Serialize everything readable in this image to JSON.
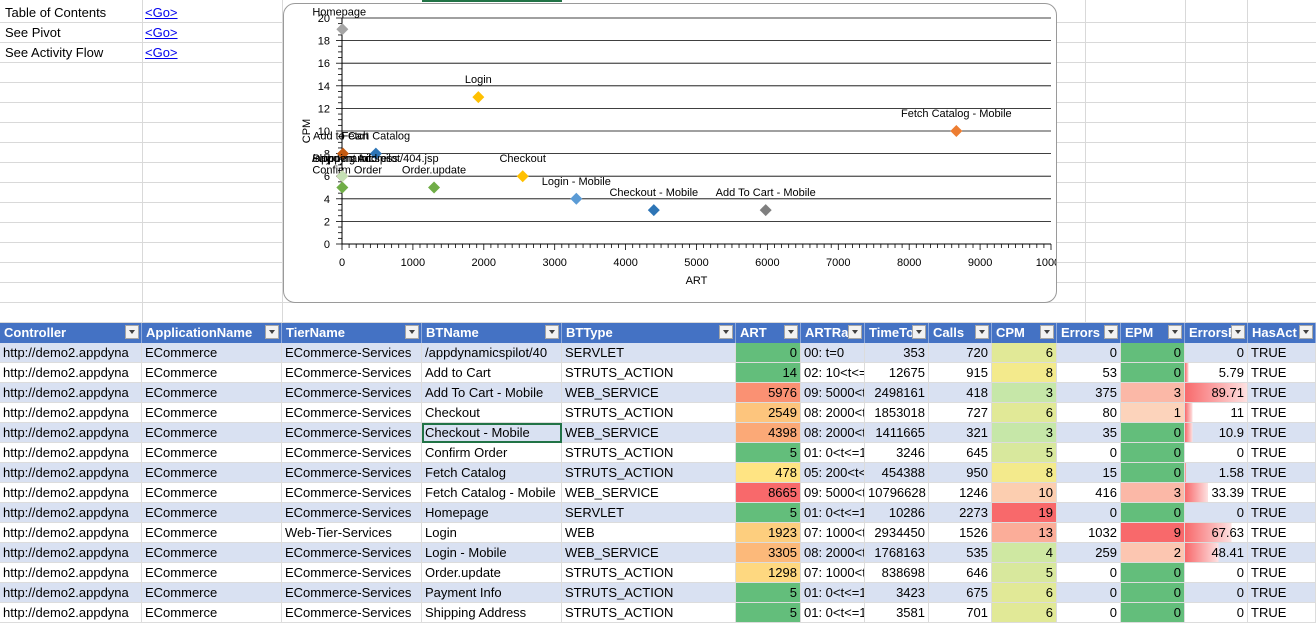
{
  "links": [
    {
      "label": "Table of Contents",
      "link": "<Go>"
    },
    {
      "label": "See Pivot",
      "link": "<Go>"
    },
    {
      "label": "See Activity Flow",
      "link": "<Go>"
    }
  ],
  "chart_data": {
    "type": "scatter",
    "title": "",
    "xlabel": "ART",
    "ylabel": "CPM",
    "xlim": [
      0,
      10000
    ],
    "ylim": [
      0,
      20
    ],
    "xticks": [
      0,
      1000,
      2000,
      3000,
      4000,
      5000,
      6000,
      7000,
      8000,
      9000,
      10000
    ],
    "yticks": [
      0,
      2,
      4,
      6,
      8,
      10,
      12,
      14,
      16,
      18,
      20
    ],
    "grid": "horizontal",
    "points": [
      {
        "label": "/appdynamicspilot/404.jsp",
        "x": 0,
        "y": 6,
        "color": "#7f7f7f"
      },
      {
        "label": "Add to Cart",
        "x": 14,
        "y": 8,
        "color": "#c55a11"
      },
      {
        "label": "Add To Cart - Mobile",
        "x": 5976,
        "y": 3,
        "color": "#7f7f7f"
      },
      {
        "label": "Checkout",
        "x": 2549,
        "y": 6,
        "color": "#ffc000"
      },
      {
        "label": "Checkout - Mobile",
        "x": 4398,
        "y": 3,
        "color": "#2e75b6"
      },
      {
        "label": "Confirm Order",
        "x": 5,
        "y": 5,
        "color": "#70ad47"
      },
      {
        "label": "Fetch Catalog",
        "x": 478,
        "y": 8,
        "color": "#2e75b6"
      },
      {
        "label": "Fetch Catalog - Mobile",
        "x": 8665,
        "y": 10,
        "color": "#ed7d31"
      },
      {
        "label": "Homepage",
        "x": 5,
        "y": 19,
        "color": "#a5a5a5"
      },
      {
        "label": "Login",
        "x": 1923,
        "y": 13,
        "color": "#ffc000"
      },
      {
        "label": "Login - Mobile",
        "x": 3305,
        "y": 4,
        "color": "#5b9bd5"
      },
      {
        "label": "Order.update",
        "x": 1298,
        "y": 5,
        "color": "#70ad47"
      },
      {
        "label": "Payment Info",
        "x": 5,
        "y": 6,
        "color": "#f4b183"
      },
      {
        "label": "Shipping Address",
        "x": 5,
        "y": 6,
        "color": "#c5e0b4"
      }
    ]
  },
  "table": {
    "headers": [
      "Controller",
      "ApplicationName",
      "TierName",
      "BTName",
      "BTType",
      "ART",
      "ARTRar",
      "TimeTo",
      "Calls",
      "CPM",
      "Errors",
      "EPM",
      "ErrorsP",
      "HasAct"
    ],
    "rows": [
      [
        "http://demo2.appdyna",
        "ECommerce",
        "ECommerce-Services",
        "/appdynamicspilot/40",
        "SERVLET",
        "0",
        "00: t=0",
        "353",
        "720",
        "6",
        "0",
        "0",
        "0",
        "TRUE"
      ],
      [
        "http://demo2.appdyna",
        "ECommerce",
        "ECommerce-Services",
        "Add to Cart",
        "STRUTS_ACTION",
        "14",
        "02: 10<t<=",
        "12675",
        "915",
        "8",
        "53",
        "0",
        "5.79",
        "TRUE"
      ],
      [
        "http://demo2.appdyna",
        "ECommerce",
        "ECommerce-Services",
        "Add To Cart - Mobile",
        "WEB_SERVICE",
        "5976",
        "09: 5000<t",
        "2498161",
        "418",
        "3",
        "375",
        "3",
        "89.71",
        "TRUE"
      ],
      [
        "http://demo2.appdyna",
        "ECommerce",
        "ECommerce-Services",
        "Checkout",
        "STRUTS_ACTION",
        "2549",
        "08: 2000<t",
        "1853018",
        "727",
        "6",
        "80",
        "1",
        "11",
        "TRUE"
      ],
      [
        "http://demo2.appdyna",
        "ECommerce",
        "ECommerce-Services",
        "Checkout - Mobile",
        "WEB_SERVICE",
        "4398",
        "08: 2000<t",
        "1411665",
        "321",
        "3",
        "35",
        "0",
        "10.9",
        "TRUE"
      ],
      [
        "http://demo2.appdyna",
        "ECommerce",
        "ECommerce-Services",
        "Confirm Order",
        "STRUTS_ACTION",
        "5",
        "01: 0<t<=1",
        "3246",
        "645",
        "5",
        "0",
        "0",
        "0",
        "TRUE"
      ],
      [
        "http://demo2.appdyna",
        "ECommerce",
        "ECommerce-Services",
        "Fetch Catalog",
        "STRUTS_ACTION",
        "478",
        "05: 200<t<",
        "454388",
        "950",
        "8",
        "15",
        "0",
        "1.58",
        "TRUE"
      ],
      [
        "http://demo2.appdyna",
        "ECommerce",
        "ECommerce-Services",
        "Fetch Catalog - Mobile",
        "WEB_SERVICE",
        "8665",
        "09: 5000<t",
        "10796628",
        "1246",
        "10",
        "416",
        "3",
        "33.39",
        "TRUE"
      ],
      [
        "http://demo2.appdyna",
        "ECommerce",
        "ECommerce-Services",
        "Homepage",
        "SERVLET",
        "5",
        "01: 0<t<=1",
        "10286",
        "2273",
        "19",
        "0",
        "0",
        "0",
        "TRUE"
      ],
      [
        "http://demo2.appdyna",
        "ECommerce",
        "Web-Tier-Services",
        "Login",
        "WEB",
        "1923",
        "07: 1000<t",
        "2934450",
        "1526",
        "13",
        "1032",
        "9",
        "67.63",
        "TRUE"
      ],
      [
        "http://demo2.appdyna",
        "ECommerce",
        "ECommerce-Services",
        "Login - Mobile",
        "WEB_SERVICE",
        "3305",
        "08: 2000<t",
        "1768163",
        "535",
        "4",
        "259",
        "2",
        "48.41",
        "TRUE"
      ],
      [
        "http://demo2.appdyna",
        "ECommerce",
        "ECommerce-Services",
        "Order.update",
        "STRUTS_ACTION",
        "1298",
        "07: 1000<t",
        "838698",
        "646",
        "5",
        "0",
        "0",
        "0",
        "TRUE"
      ],
      [
        "http://demo2.appdyna",
        "ECommerce",
        "ECommerce-Services",
        "Payment Info",
        "STRUTS_ACTION",
        "5",
        "01: 0<t<=1",
        "3423",
        "675",
        "6",
        "0",
        "0",
        "0",
        "TRUE"
      ],
      [
        "http://demo2.appdyna",
        "ECommerce",
        "ECommerce-Services",
        "Shipping Address",
        "STRUTS_ACTION",
        "5",
        "01: 0<t<=1",
        "3581",
        "701",
        "6",
        "0",
        "0",
        "0",
        "TRUE"
      ]
    ],
    "selected_cell": "Checkout - Mobile"
  },
  "colors": {
    "header_bg": "#4472c4",
    "band_row": "#d9e1f2",
    "art_low": "#63be7b",
    "art_high": "#f8696b",
    "cpm_low": "#ffeb84",
    "cpm_high": "#f8696b",
    "epm_low": "#63be7b",
    "databar": "#f8696b",
    "selection": "#217346"
  }
}
